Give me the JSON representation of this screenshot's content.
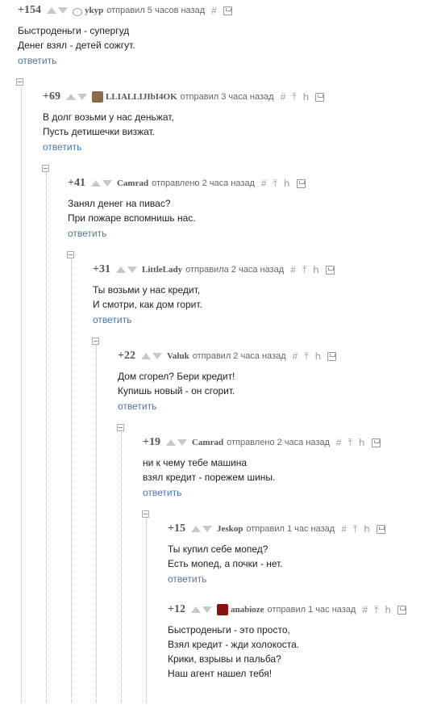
{
  "comments": [
    {
      "rating": "+154",
      "author": "ykyp",
      "meta": "отправил 5 часов назад",
      "lines": [
        "Быстроденьги - супергуд",
        "Денег взял - детей сожгут."
      ],
      "reply": "ответить",
      "hash": "#",
      "avatar": "guest",
      "avatar_color": "#ffffff"
    },
    {
      "rating": "+69",
      "author": "LLIALLIJIbI4OK",
      "meta": "отправил 3 часа назад",
      "lines": [
        "В долг возьми у нас деньжат,",
        "Пусть детишечки визжат."
      ],
      "reply": "ответить",
      "hash": "#",
      "avatar": "photo",
      "avatar_color": "#8a6a4a"
    },
    {
      "rating": "+41",
      "author": "Camrad",
      "meta": "отправлено 2 часа назад",
      "lines": [
        "Занял денег на пивас?",
        "При пожаре вспомнишь нас."
      ],
      "reply": "ответить",
      "hash": "#"
    },
    {
      "rating": "+31",
      "author": "LittleLady",
      "meta": "отправила 2 часа назад",
      "lines": [
        "Ты возьми у нас кредит,",
        "И смотри, как дом горит."
      ],
      "reply": "ответить",
      "hash": "#"
    },
    {
      "rating": "+22",
      "author": "Valuk",
      "meta": "отправил 2 часа назад",
      "lines": [
        "Дом сгорел? Бери кредит!",
        "Купишь новый - он сгорит."
      ],
      "reply": "ответить",
      "hash": "#"
    },
    {
      "rating": "+19",
      "author": "Camrad",
      "meta": "отправлено 2 часа назад",
      "lines": [
        "ни к чему тебе машина",
        "взял кредит - порежем шины."
      ],
      "reply": "ответить",
      "hash": "#"
    },
    {
      "rating": "+15",
      "author": "Jeskop",
      "meta": "отправил 1 час назад",
      "lines": [
        "Ты купил себе мопед?",
        "Есть мопед, а почки - нет."
      ],
      "reply": "ответить",
      "hash": "#"
    },
    {
      "rating": "+12",
      "author": "anabioze",
      "meta": "отправил 1 час назад",
      "lines": [
        "Быстроденьги - это просто,",
        "Взял кредит - жди холокоста.",
        "Крики, взрывы и пальба?",
        "Наш агент нашел тебя!"
      ],
      "reply": "",
      "hash": "#",
      "avatar": "photo",
      "avatar_color": "#8b1010"
    }
  ],
  "icons": {
    "up": "arrow-up-icon",
    "down": "arrow-down-icon",
    "parent": "parent-arrow-icon",
    "branch": "branch-icon",
    "save": "save-icon"
  }
}
